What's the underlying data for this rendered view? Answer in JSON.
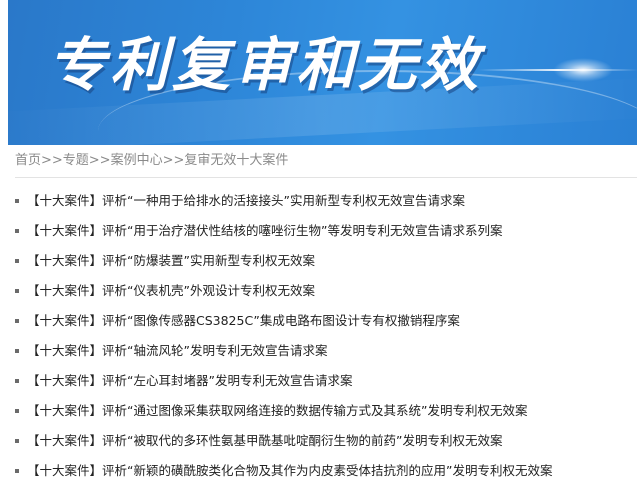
{
  "banner": {
    "title": "专利复审和无效",
    "colors": {
      "background": "#2d86d8",
      "text": "#ffffff"
    }
  },
  "breadcrumb": {
    "items": [
      "首页",
      "专题",
      "案例中心",
      "复审无效十大案件"
    ],
    "separator": ">>",
    "text": "首页>>专题>>案例中心>>复审无效十大案件"
  },
  "cases": [
    "【十大案件】评析“一种用于给排水的活接接头”实用新型专利权无效宣告请求案",
    "【十大案件】评析“用于治疗潜伏性结核的噻唑衍生物”等发明专利无效宣告请求系列案",
    "【十大案件】评析“防爆装置”实用新型专利权无效案",
    "【十大案件】评析“仪表机壳”外观设计专利权无效案",
    "【十大案件】评析“图像传感器CS3825C”集成电路布图设计专有权撤销程序案",
    "【十大案件】评析“轴流风轮”发明专利无效宣告请求案",
    "【十大案件】评析“左心耳封堵器”发明专利无效宣告请求案",
    "【十大案件】评析“通过图像采集获取网络连接的数据传输方式及其系统”发明专利权无效案",
    "【十大案件】评析“被取代的多环性氨基甲酰基吡啶酮衍生物的前药”发明专利权无效案",
    "【十大案件】评析“新颖的磺酰胺类化合物及其作为内皮素受体拮抗剂的应用”发明专利权无效案"
  ]
}
